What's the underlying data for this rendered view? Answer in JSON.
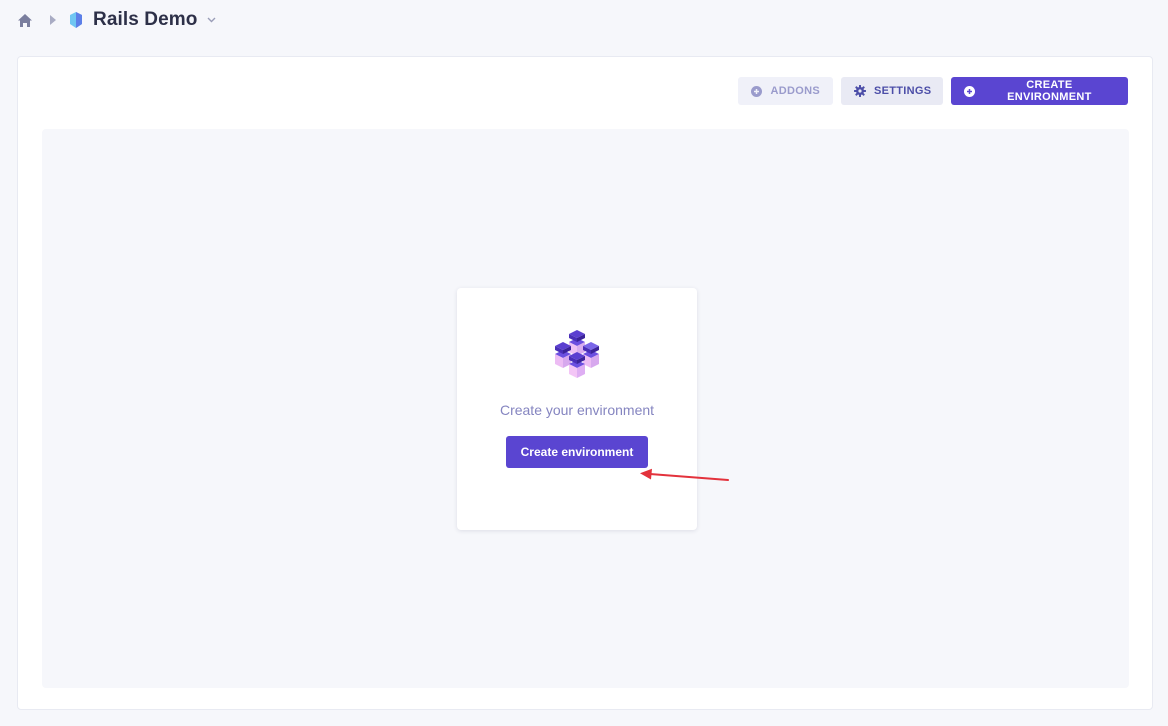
{
  "breadcrumb": {
    "project_title": "Rails Demo"
  },
  "toolbar": {
    "addons_label": "ADDONS",
    "settings_label": "SETTINGS",
    "create_environment_label": "CREATE ENVIRONMENT"
  },
  "empty_state": {
    "message": "Create your environment",
    "button_label": "Create environment"
  },
  "colors": {
    "accent": "#5a45d1",
    "annotation_arrow": "#e3323c",
    "background": "#f6f7fb"
  },
  "icons": [
    "home-icon",
    "breadcrumb-caret-icon",
    "project-logo-icon",
    "chevron-down-icon",
    "plus-circle-icon",
    "gear-icon",
    "cubes-illustration"
  ]
}
